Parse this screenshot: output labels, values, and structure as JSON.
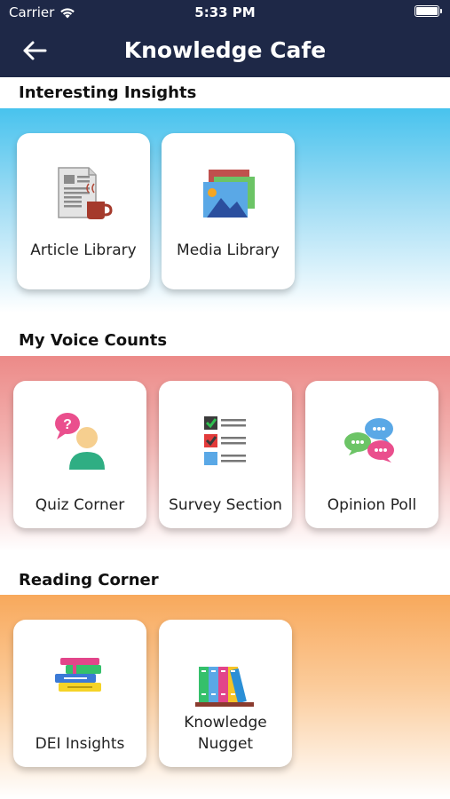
{
  "status_bar": {
    "carrier": "Carrier",
    "time": "5:33 PM"
  },
  "header": {
    "title": "Knowledge Cafe",
    "back_icon": "arrow-left-icon"
  },
  "sections": [
    {
      "title": "Interesting Insights",
      "color": "#48c3ee",
      "items": [
        {
          "label": "Article Library",
          "icon": "article-icon"
        },
        {
          "label": "Media Library",
          "icon": "media-icon"
        }
      ]
    },
    {
      "title": "My Voice Counts",
      "color": "#ec8a88",
      "items": [
        {
          "label": "Quiz Corner",
          "icon": "quiz-icon"
        },
        {
          "label": "Survey Section",
          "icon": "survey-icon"
        },
        {
          "label": "Opinion Poll",
          "icon": "poll-icon"
        }
      ]
    },
    {
      "title": "Reading Corner",
      "color": "#f8a95c",
      "items": [
        {
          "label": "DEI Insights",
          "icon": "books-stack-icon"
        },
        {
          "label_line1": "Knowledge",
          "label_line2": "Nugget",
          "icon": "bookshelf-icon"
        }
      ]
    }
  ]
}
